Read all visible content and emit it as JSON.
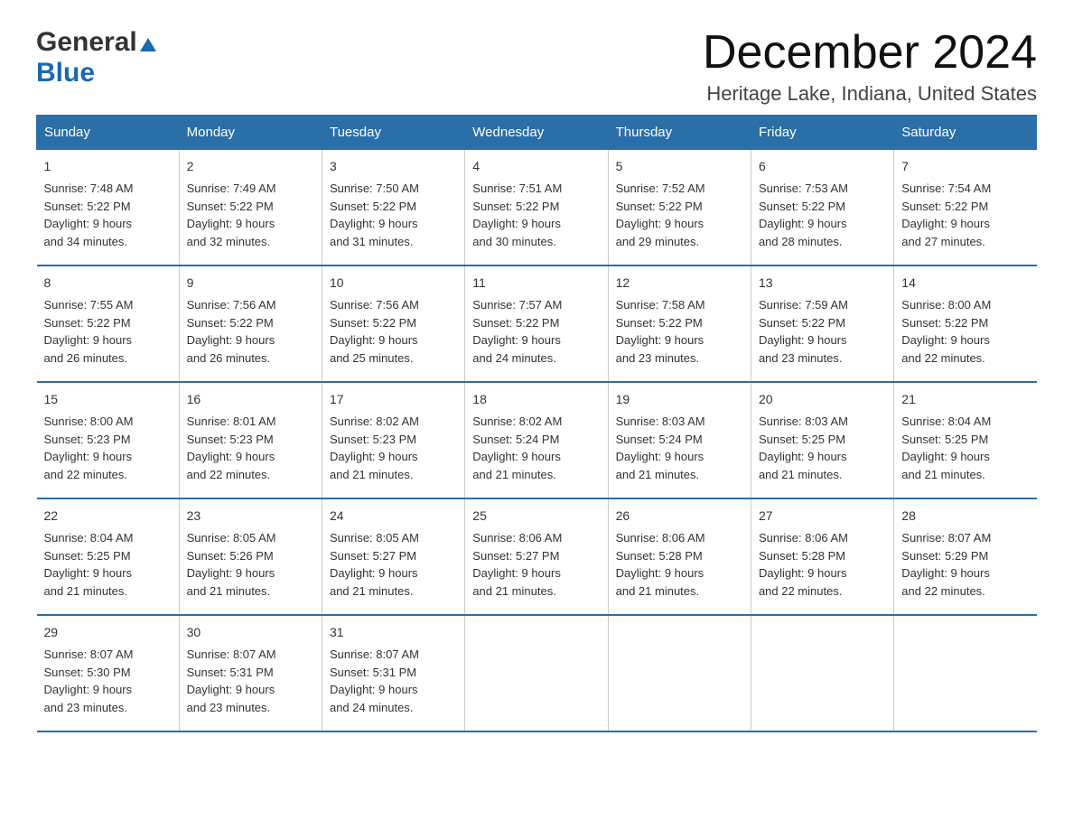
{
  "logo": {
    "general": "General",
    "blue": "Blue",
    "triangle": "▲"
  },
  "title": "December 2024",
  "subtitle": "Heritage Lake, Indiana, United States",
  "days_of_week": [
    "Sunday",
    "Monday",
    "Tuesday",
    "Wednesday",
    "Thursday",
    "Friday",
    "Saturday"
  ],
  "weeks": [
    [
      {
        "day": "1",
        "info": "Sunrise: 7:48 AM\nSunset: 5:22 PM\nDaylight: 9 hours\nand 34 minutes."
      },
      {
        "day": "2",
        "info": "Sunrise: 7:49 AM\nSunset: 5:22 PM\nDaylight: 9 hours\nand 32 minutes."
      },
      {
        "day": "3",
        "info": "Sunrise: 7:50 AM\nSunset: 5:22 PM\nDaylight: 9 hours\nand 31 minutes."
      },
      {
        "day": "4",
        "info": "Sunrise: 7:51 AM\nSunset: 5:22 PM\nDaylight: 9 hours\nand 30 minutes."
      },
      {
        "day": "5",
        "info": "Sunrise: 7:52 AM\nSunset: 5:22 PM\nDaylight: 9 hours\nand 29 minutes."
      },
      {
        "day": "6",
        "info": "Sunrise: 7:53 AM\nSunset: 5:22 PM\nDaylight: 9 hours\nand 28 minutes."
      },
      {
        "day": "7",
        "info": "Sunrise: 7:54 AM\nSunset: 5:22 PM\nDaylight: 9 hours\nand 27 minutes."
      }
    ],
    [
      {
        "day": "8",
        "info": "Sunrise: 7:55 AM\nSunset: 5:22 PM\nDaylight: 9 hours\nand 26 minutes."
      },
      {
        "day": "9",
        "info": "Sunrise: 7:56 AM\nSunset: 5:22 PM\nDaylight: 9 hours\nand 26 minutes."
      },
      {
        "day": "10",
        "info": "Sunrise: 7:56 AM\nSunset: 5:22 PM\nDaylight: 9 hours\nand 25 minutes."
      },
      {
        "day": "11",
        "info": "Sunrise: 7:57 AM\nSunset: 5:22 PM\nDaylight: 9 hours\nand 24 minutes."
      },
      {
        "day": "12",
        "info": "Sunrise: 7:58 AM\nSunset: 5:22 PM\nDaylight: 9 hours\nand 23 minutes."
      },
      {
        "day": "13",
        "info": "Sunrise: 7:59 AM\nSunset: 5:22 PM\nDaylight: 9 hours\nand 23 minutes."
      },
      {
        "day": "14",
        "info": "Sunrise: 8:00 AM\nSunset: 5:22 PM\nDaylight: 9 hours\nand 22 minutes."
      }
    ],
    [
      {
        "day": "15",
        "info": "Sunrise: 8:00 AM\nSunset: 5:23 PM\nDaylight: 9 hours\nand 22 minutes."
      },
      {
        "day": "16",
        "info": "Sunrise: 8:01 AM\nSunset: 5:23 PM\nDaylight: 9 hours\nand 22 minutes."
      },
      {
        "day": "17",
        "info": "Sunrise: 8:02 AM\nSunset: 5:23 PM\nDaylight: 9 hours\nand 21 minutes."
      },
      {
        "day": "18",
        "info": "Sunrise: 8:02 AM\nSunset: 5:24 PM\nDaylight: 9 hours\nand 21 minutes."
      },
      {
        "day": "19",
        "info": "Sunrise: 8:03 AM\nSunset: 5:24 PM\nDaylight: 9 hours\nand 21 minutes."
      },
      {
        "day": "20",
        "info": "Sunrise: 8:03 AM\nSunset: 5:25 PM\nDaylight: 9 hours\nand 21 minutes."
      },
      {
        "day": "21",
        "info": "Sunrise: 8:04 AM\nSunset: 5:25 PM\nDaylight: 9 hours\nand 21 minutes."
      }
    ],
    [
      {
        "day": "22",
        "info": "Sunrise: 8:04 AM\nSunset: 5:25 PM\nDaylight: 9 hours\nand 21 minutes."
      },
      {
        "day": "23",
        "info": "Sunrise: 8:05 AM\nSunset: 5:26 PM\nDaylight: 9 hours\nand 21 minutes."
      },
      {
        "day": "24",
        "info": "Sunrise: 8:05 AM\nSunset: 5:27 PM\nDaylight: 9 hours\nand 21 minutes."
      },
      {
        "day": "25",
        "info": "Sunrise: 8:06 AM\nSunset: 5:27 PM\nDaylight: 9 hours\nand 21 minutes."
      },
      {
        "day": "26",
        "info": "Sunrise: 8:06 AM\nSunset: 5:28 PM\nDaylight: 9 hours\nand 21 minutes."
      },
      {
        "day": "27",
        "info": "Sunrise: 8:06 AM\nSunset: 5:28 PM\nDaylight: 9 hours\nand 22 minutes."
      },
      {
        "day": "28",
        "info": "Sunrise: 8:07 AM\nSunset: 5:29 PM\nDaylight: 9 hours\nand 22 minutes."
      }
    ],
    [
      {
        "day": "29",
        "info": "Sunrise: 8:07 AM\nSunset: 5:30 PM\nDaylight: 9 hours\nand 23 minutes."
      },
      {
        "day": "30",
        "info": "Sunrise: 8:07 AM\nSunset: 5:31 PM\nDaylight: 9 hours\nand 23 minutes."
      },
      {
        "day": "31",
        "info": "Sunrise: 8:07 AM\nSunset: 5:31 PM\nDaylight: 9 hours\nand 24 minutes."
      },
      {
        "day": "",
        "info": ""
      },
      {
        "day": "",
        "info": ""
      },
      {
        "day": "",
        "info": ""
      },
      {
        "day": "",
        "info": ""
      }
    ]
  ]
}
